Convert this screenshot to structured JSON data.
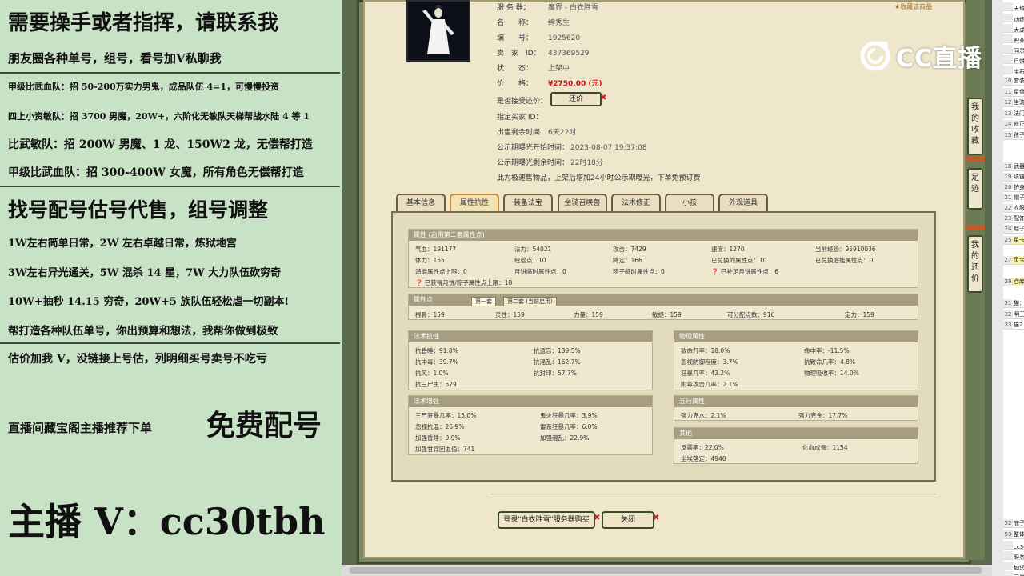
{
  "ad_panel": {
    "lines": [
      "需要操手或者指挥，请联系我",
      "朋友圈各种单号，组号，看号加V私聊我",
      "甲级比武血队：招 50-200万实力男鬼，成品队伍 4=1，可慢慢投资",
      "四上小资敏队：招 3700 男魔，20W+，六阶化无敏队天梯帮战水陆 4 等 1",
      "比武敏队：招 200W 男魔、1 龙、150W2 龙，无偿帮打造",
      "甲级比武血队：招 300-400W 女魔，所有角色无偿帮打造",
      "找号配号估号代售，组号调整",
      "1W左右简单日常，2W 左右卓越日常，炼狱地宫",
      "3W左右异光通关，5W 混杀 14 星，7W 大力队伍砍穷奇",
      "10W+抽秒 14.15 穷奇，20W+5 族队伍轻松虐一切副本!",
      "帮打造各种队伍单号，你出预算和想法，我帮你做到极致",
      "估价加我 V，没链接上号估，列明细买号卖号不吃亏",
      "直播间藏宝阁主播推荐下单",
      "免费配号",
      "主播 V：cc30tbh"
    ]
  },
  "listing": {
    "fav_link": "收藏该商品",
    "rows": [
      {
        "label": "服 务 器：",
        "value": "魔界 - 白衣胜雪"
      },
      {
        "label": "名　　称：",
        "value": "绅秀生"
      },
      {
        "label": "编　　号：",
        "value": "1925620"
      },
      {
        "label": "卖　家　ID：",
        "value": "437369529"
      },
      {
        "label": "状　　态：",
        "value": "上架中"
      },
      {
        "label": "价　　格：",
        "value": "¥2750.00 (元)"
      },
      {
        "label": "是否接受还价：",
        "value": ""
      },
      {
        "label": "指定买家 ID：",
        "value": ""
      },
      {
        "label": "出售剩余时间：",
        "value": "6天22时"
      },
      {
        "label": "公示期曝光开始时间：",
        "value": "2023-08-07 19:37:08"
      },
      {
        "label": "公示期曝光剩余时间：",
        "value": "22时18分"
      }
    ],
    "haggle_button": "还价",
    "note": "此为极速售物品，上架后增加24小时公示期曝光，下单免预订费"
  },
  "tabs": [
    "基本信息",
    "属性抗性",
    "装备法宝",
    "坐骑召唤兽",
    "法术修正",
    "小孩",
    "外观道具"
  ],
  "attributes": {
    "header": "属性 (启用第二套属性点)",
    "rows": [
      [
        "气血：191177",
        "法力：54021",
        "攻击：7429",
        "速度：1270",
        "当前经验：95910036"
      ],
      [
        "体力：155",
        "经验点：10",
        "降定：166",
        "已兑换的属性点：10",
        "已兑换潜能属性点：0"
      ],
      [
        "潜能属性点上限：0",
        "月饼临时属性点：0",
        "粽子临时属性点：0",
        "已补足月饼属性点：6",
        ""
      ]
    ],
    "extra": "已获得月饼/粽子属性点上限：18"
  },
  "attr_points": {
    "header": "属性点",
    "subtabs": [
      "第一套",
      "第二套 (当前启用)"
    ],
    "values": [
      "根骨：159",
      "灵性：159",
      "力量：159",
      "敏捷：159",
      "可分配点数：916",
      "定力：159"
    ]
  },
  "spell_resist": {
    "header": "法术抗性",
    "cells": [
      "抗昏睡：91.8%",
      "抗遗忘：139.5%",
      "抗中毒：39.7%",
      "抗混乱：162.7%",
      "抗风：1.0%",
      "抗封印：57.7%",
      "抗三尸虫：579"
    ]
  },
  "spell_boost": {
    "header": "法术增强",
    "cells": [
      "三尸狂暴几率：15.0%",
      "鬼火狂暴几率：3.9%",
      "忽视抗混：26.9%",
      "雷系狂暴几率：6.0%",
      "加强昏睡：9.9%",
      "加强混乱：22.9%",
      "加强甘霖回血值：741"
    ]
  },
  "physical": {
    "header": "物理属性",
    "cells": [
      "致命几率：18.0%",
      "命中率：-11.5%",
      "忽视防御程度：3.7%",
      "抗致命几率：4.8%",
      "狂暴几率：43.2%",
      "物理吸收率：14.0%",
      "附毒攻击几率：2.1%"
    ]
  },
  "five_elements": {
    "header": "五行属性",
    "cells": [
      "强力克水：2.1%",
      "强力克金：17.7%"
    ]
  },
  "other": {
    "header": "其他",
    "cells": [
      "反震率：22.0%",
      "化血成骨：1154",
      "尘埃落定：4940"
    ]
  },
  "buttons": {
    "login": "登录\"白衣胜雪\"服务器购买",
    "close": "关闭"
  },
  "side_tabs": [
    "我的收藏",
    "足迹",
    "我的还价"
  ],
  "overlay": {
    "logo_text": "CC直播"
  },
  "sheet": {
    "rows": [
      {
        "n": "",
        "t": "天域"
      },
      {
        "n": "",
        "t": "功绩"
      },
      {
        "n": "",
        "t": "大成"
      },
      {
        "n": "",
        "t": "职业"
      },
      {
        "n": "",
        "t": "回灵"
      },
      {
        "n": "",
        "t": "月饼"
      },
      {
        "n": "",
        "t": "宝石"
      },
      {
        "n": "10",
        "t": "套装"
      },
      {
        "n": "11",
        "t": "星盘"
      },
      {
        "n": "12",
        "t": "坐骑"
      },
      {
        "n": "13",
        "t": "法门"
      },
      {
        "n": "14",
        "t": "修正"
      },
      {
        "n": "15",
        "t": "孩子"
      },
      {
        "n": "18",
        "t": "武器"
      },
      {
        "n": "19",
        "t": "项链"
      },
      {
        "n": "20",
        "t": "护身"
      },
      {
        "n": "21",
        "t": "帽子"
      },
      {
        "n": "22",
        "t": "衣服"
      },
      {
        "n": "23",
        "t": "配饰"
      },
      {
        "n": "24",
        "t": "鞋子"
      },
      {
        "n": "25",
        "t": "星卡"
      },
      {
        "n": "27",
        "t": "灵宝"
      },
      {
        "n": "29",
        "t": "仓库"
      },
      {
        "n": "31",
        "t": "猫："
      },
      {
        "n": "32",
        "t": "明王"
      },
      {
        "n": "33",
        "t": "猫2"
      },
      {
        "n": "52",
        "t": "底子"
      },
      {
        "n": "53",
        "t": "整体"
      },
      {
        "n": "",
        "t": "cc30"
      },
      {
        "n": "",
        "t": "服务"
      },
      {
        "n": "",
        "t": "如您"
      },
      {
        "n": "",
        "t": "可做"
      }
    ]
  }
}
